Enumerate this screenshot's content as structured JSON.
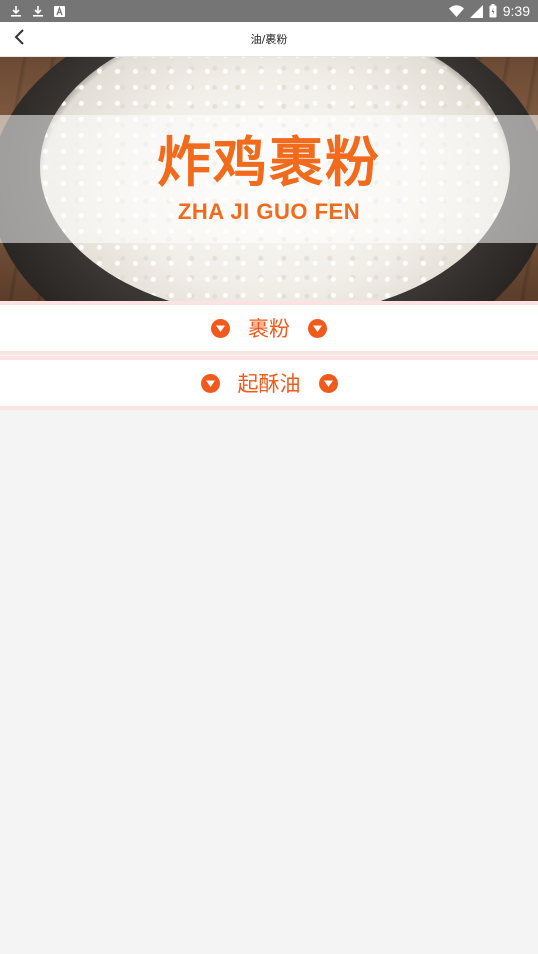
{
  "status_bar": {
    "time": "9:39",
    "left_icons": [
      "download-icon",
      "download-icon",
      "keyboard-a-icon"
    ],
    "right_icons": [
      "wifi-icon",
      "signal-icon",
      "battery-icon"
    ]
  },
  "header": {
    "title": "油/裹粉",
    "back_icon": "chevron-left-icon"
  },
  "banner": {
    "title": "炸鸡裹粉",
    "subtitle": "ZHA JI GUO FEN"
  },
  "categories": [
    {
      "label": "裹粉"
    },
    {
      "label": "起酥油"
    }
  ],
  "colors": {
    "accent": "#f05a1a",
    "row_border": "#fbe3e3",
    "status_bar": "#757575",
    "background": "#f4f4f4"
  }
}
